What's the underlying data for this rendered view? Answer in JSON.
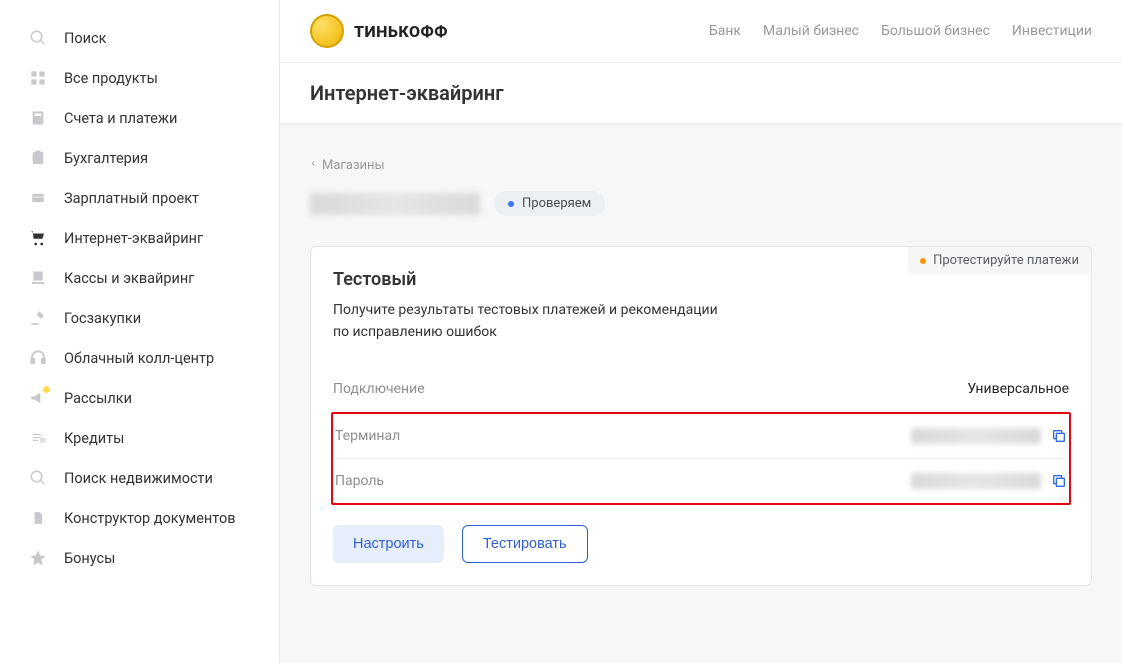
{
  "sidebar": {
    "items": [
      {
        "label": "Поиск"
      },
      {
        "label": "Все продукты"
      },
      {
        "label": "Счета и платежи"
      },
      {
        "label": "Бухгалтерия"
      },
      {
        "label": "Зарплатный проект"
      },
      {
        "label": "Интернет-эквайринг"
      },
      {
        "label": "Кассы и эквайринг"
      },
      {
        "label": "Госзакупки"
      },
      {
        "label": "Облачный колл-центр"
      },
      {
        "label": "Рассылки"
      },
      {
        "label": "Кредиты"
      },
      {
        "label": "Поиск недвижимости"
      },
      {
        "label": "Конструктор документов"
      },
      {
        "label": "Бонусы"
      }
    ]
  },
  "brand": {
    "name": "ТИНЬКОФФ"
  },
  "topnav": {
    "items": [
      "Банк",
      "Малый бизнес",
      "Большой бизнес",
      "Инвестиции"
    ]
  },
  "page": {
    "title": "Интернет-эквайринг"
  },
  "breadcrumb": {
    "label": "Магазины"
  },
  "status": {
    "label": "Проверяем"
  },
  "card": {
    "badge": "Протестируйте платежи",
    "title": "Тестовый",
    "desc_line1": "Получите результаты тестовых платежей и рекомендации",
    "desc_line2": "по исправлению ошибок",
    "rows": {
      "connection_label": "Подключение",
      "connection_value": "Универсальное",
      "terminal_label": "Терминал",
      "password_label": "Пароль"
    },
    "actions": {
      "configure": "Настроить",
      "test": "Тестировать"
    }
  }
}
